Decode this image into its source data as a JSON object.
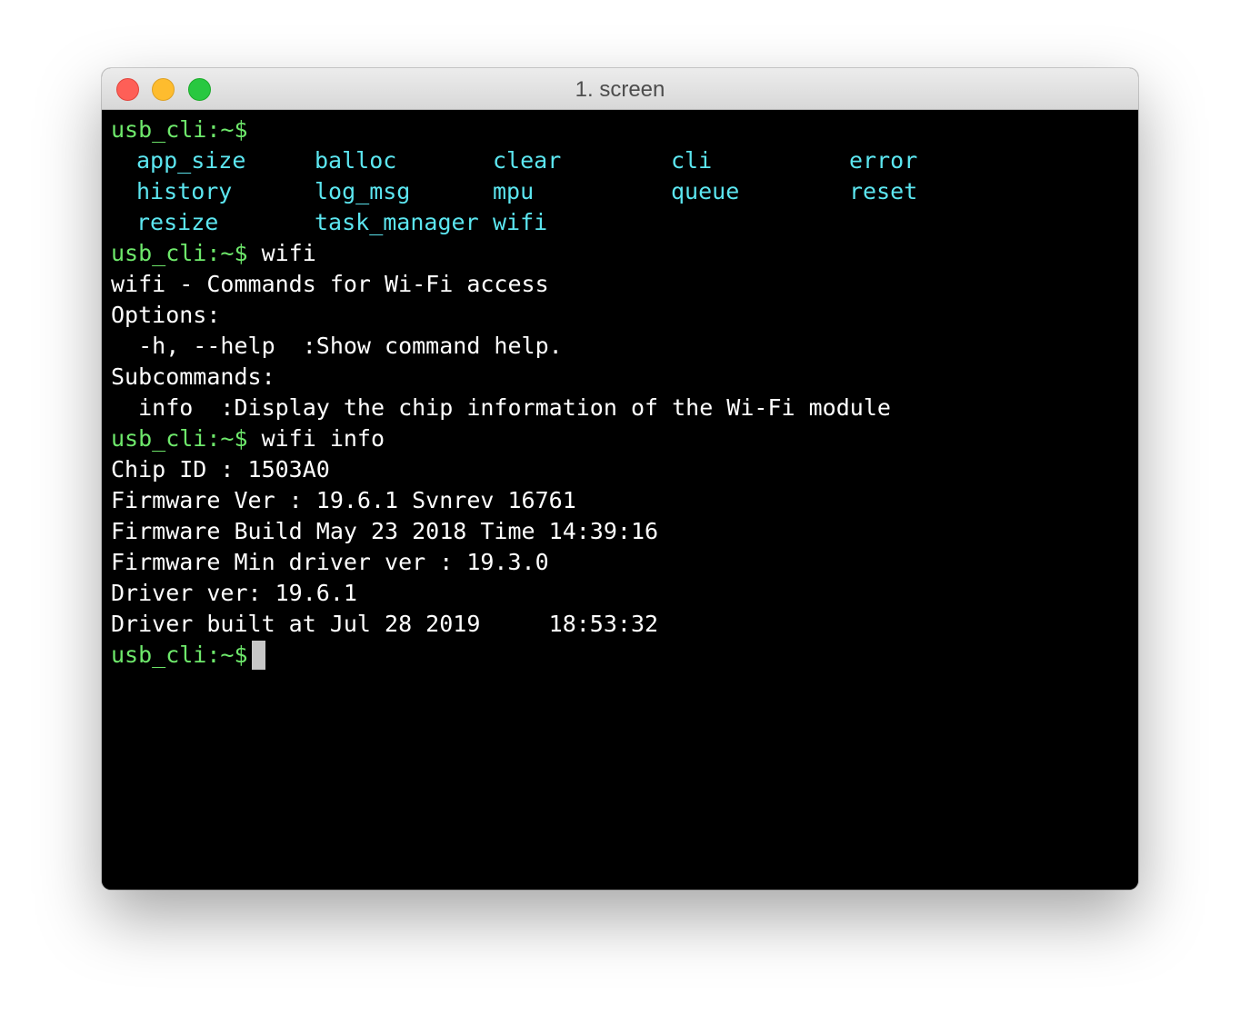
{
  "window": {
    "title": "1. screen"
  },
  "colors": {
    "prompt": "#6ee86b",
    "command_list": "#5ce6f0",
    "text": "#ffffff",
    "background": "#000000"
  },
  "terminal": {
    "prompt": "usb_cli:~$",
    "commands_grid": [
      [
        "app_size",
        "balloc",
        "clear",
        "cli",
        "error"
      ],
      [
        "history",
        "log_msg",
        "mpu",
        "queue",
        "reset"
      ],
      [
        "resize",
        "task_manager",
        "wifi"
      ]
    ],
    "cmd1": "wifi",
    "help": {
      "header": "wifi - Commands for Wi-Fi access",
      "options_label": "Options:",
      "option_help": "  -h, --help  :Show command help.",
      "subcommands_label": "Subcommands:",
      "subcommand_info": "  info  :Display the chip information of the Wi-Fi module"
    },
    "cmd2": "wifi info",
    "info_lines": [
      "Chip ID : 1503A0",
      "Firmware Ver : 19.6.1 Svnrev 16761",
      "Firmware Build May 23 2018 Time 14:39:16",
      "Firmware Min driver ver : 19.3.0",
      "Driver ver: 19.6.1",
      "Driver built at Jul 28 2019     18:53:32"
    ]
  }
}
